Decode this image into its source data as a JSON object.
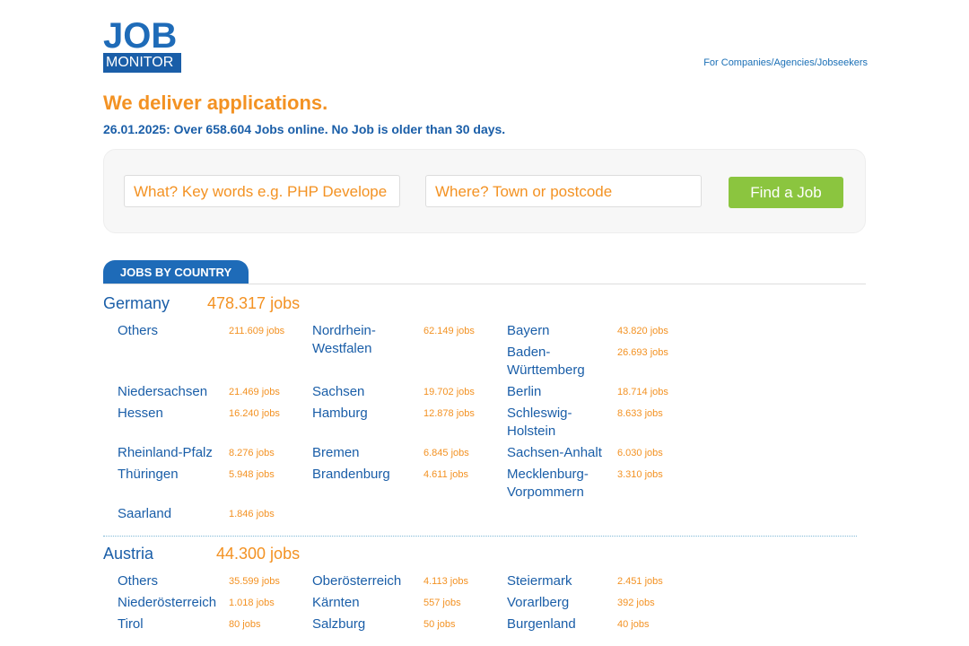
{
  "logo": {
    "line1": "JOB",
    "line2": "MONITOR"
  },
  "top_link": "For Companies/Agencies/Jobseekers",
  "tagline": "We deliver applications.",
  "stats": "26.01.2025: Over 658.604 Jobs online. No Job is older than 30 days.",
  "search": {
    "what_placeholder": "What? Key words e.g. PHP Develope",
    "where_placeholder": "Where? Town or postcode",
    "button": "Find a Job"
  },
  "section_title": "JOBS BY COUNTRY",
  "countries": [
    {
      "name": "Germany",
      "count": "478.317 jobs",
      "regions": [
        {
          "name": "Others",
          "count": "211.609 jobs"
        },
        {
          "name": "Nordrhein-Westfalen",
          "count": "62.149 jobs"
        },
        {
          "name": "Bayern",
          "count": "43.820 jobs"
        },
        {
          "name": "Baden-Württemberg",
          "count": "26.693 jobs"
        },
        {
          "name": "Niedersachsen",
          "count": "21.469 jobs"
        },
        {
          "name": "Sachsen",
          "count": "19.702 jobs"
        },
        {
          "name": "Berlin",
          "count": "18.714 jobs"
        },
        {
          "name": "Hessen",
          "count": "16.240 jobs"
        },
        {
          "name": "Hamburg",
          "count": "12.878 jobs"
        },
        {
          "name": "Schleswig-Holstein",
          "count": "8.633 jobs"
        },
        {
          "name": "Rheinland-Pfalz",
          "count": "8.276 jobs"
        },
        {
          "name": "Bremen",
          "count": "6.845 jobs"
        },
        {
          "name": "Sachsen-Anhalt",
          "count": "6.030 jobs"
        },
        {
          "name": "Thüringen",
          "count": "5.948 jobs"
        },
        {
          "name": "Brandenburg",
          "count": "4.611 jobs"
        },
        {
          "name": "Mecklenburg-Vorpommern",
          "count": "3.310 jobs"
        },
        {
          "name": "Saarland",
          "count": "1.846 jobs"
        }
      ]
    },
    {
      "name": "Austria",
      "count": "44.300 jobs",
      "regions": [
        {
          "name": "Others",
          "count": "35.599 jobs"
        },
        {
          "name": "Oberösterreich",
          "count": "4.113 jobs"
        },
        {
          "name": "Steiermark",
          "count": "2.451 jobs"
        },
        {
          "name": "Niederösterreich",
          "count": "1.018 jobs"
        },
        {
          "name": "Kärnten",
          "count": "557 jobs"
        },
        {
          "name": "Vorarlberg",
          "count": "392 jobs"
        },
        {
          "name": "Tirol",
          "count": "80 jobs"
        },
        {
          "name": "Salzburg",
          "count": "50 jobs"
        },
        {
          "name": "Burgenland",
          "count": "40 jobs"
        }
      ]
    }
  ]
}
